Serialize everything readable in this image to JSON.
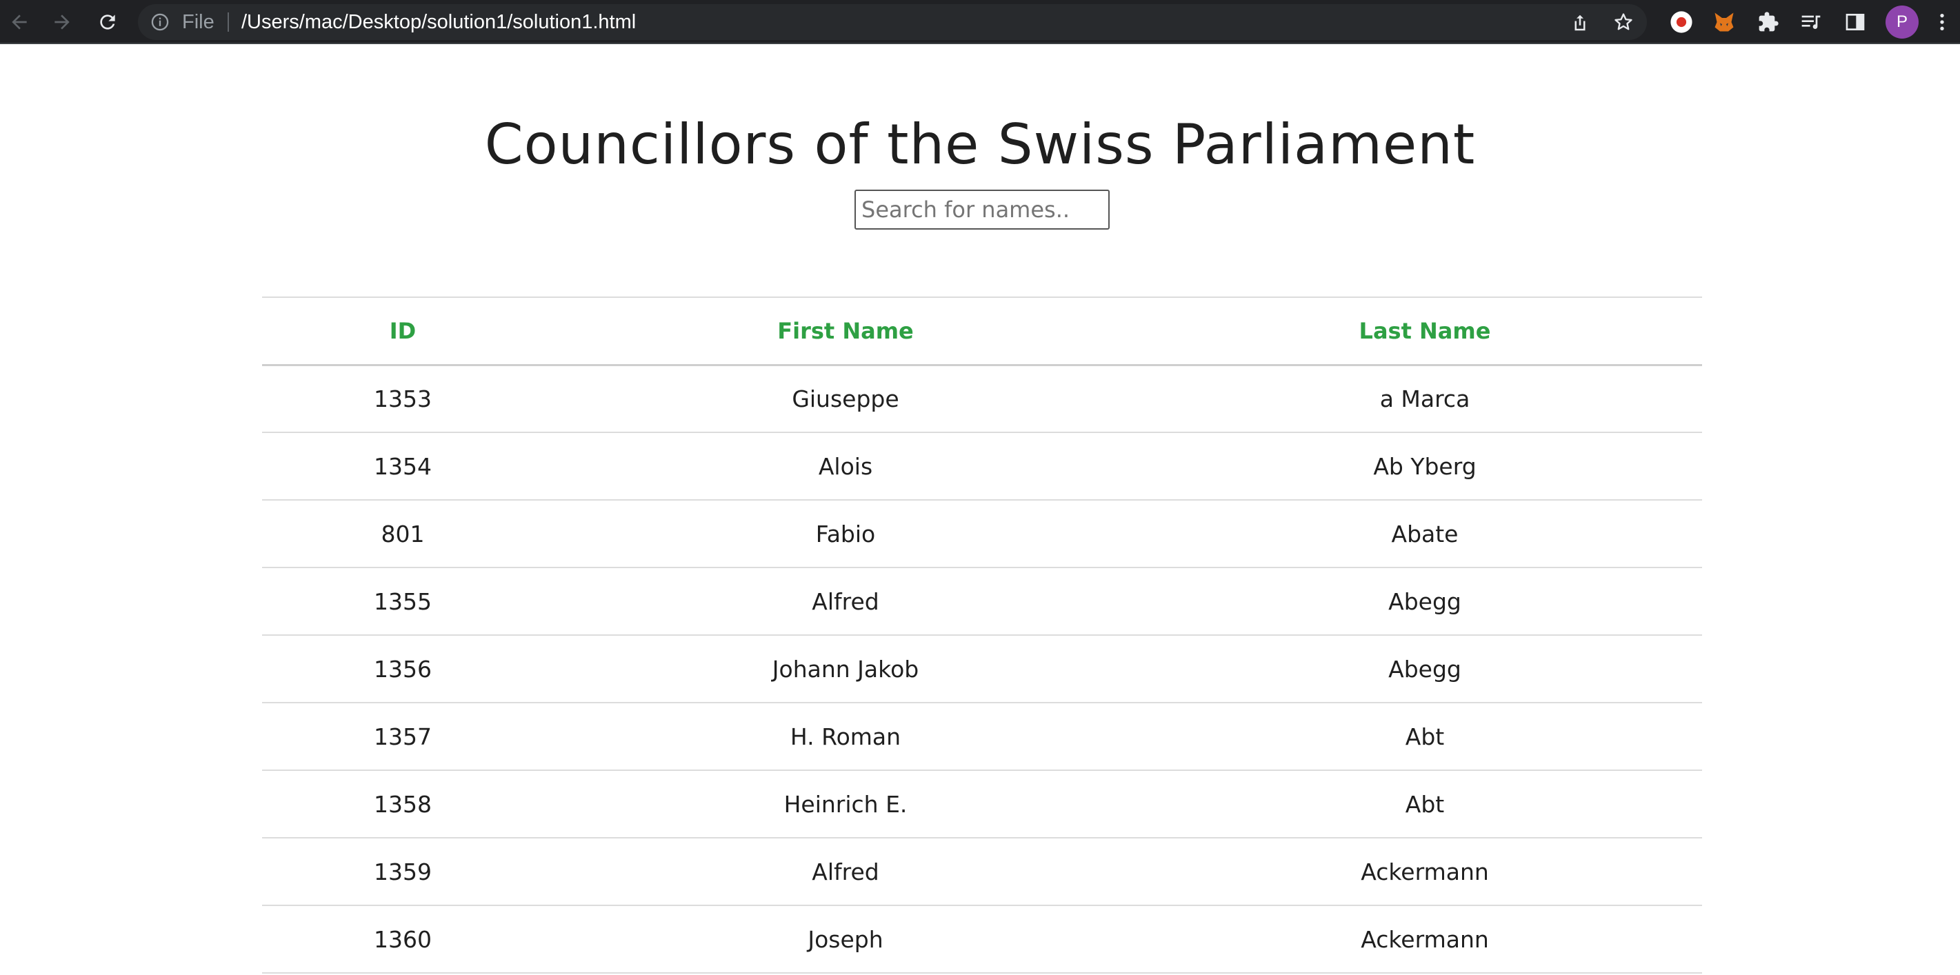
{
  "browser": {
    "scheme_label": "File",
    "url": "/Users/mac/Desktop/solution1/solution1.html",
    "profile_initial": "P"
  },
  "page": {
    "title": "Councillors of the Swiss Parliament",
    "search_placeholder": "Search for names.."
  },
  "table": {
    "headers": [
      "ID",
      "First Name",
      "Last Name"
    ],
    "header_color": "#2ea043",
    "rows": [
      {
        "id": "1353",
        "first": "Giuseppe",
        "last": "a Marca"
      },
      {
        "id": "1354",
        "first": "Alois",
        "last": "Ab Yberg"
      },
      {
        "id": "801",
        "first": "Fabio",
        "last": "Abate"
      },
      {
        "id": "1355",
        "first": "Alfred",
        "last": "Abegg"
      },
      {
        "id": "1356",
        "first": "Johann Jakob",
        "last": "Abegg"
      },
      {
        "id": "1357",
        "first": "H. Roman",
        "last": "Abt"
      },
      {
        "id": "1358",
        "first": "Heinrich E.",
        "last": "Abt"
      },
      {
        "id": "1359",
        "first": "Alfred",
        "last": "Ackermann"
      },
      {
        "id": "1360",
        "first": "Joseph",
        "last": "Ackermann"
      }
    ]
  }
}
